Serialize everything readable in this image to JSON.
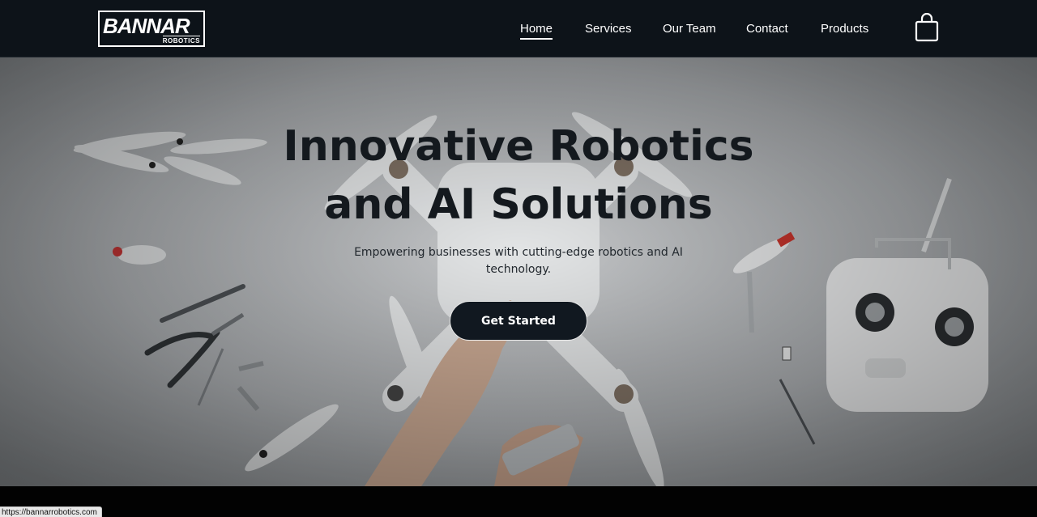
{
  "navbar": {
    "logo": {
      "main": "BANNAR",
      "sub": "ROBOTICS"
    },
    "links": [
      {
        "label": "Home",
        "active": true
      },
      {
        "label": "Services",
        "active": false
      },
      {
        "label": "Our Team",
        "active": false
      },
      {
        "label": "Contact",
        "active": false
      },
      {
        "label": "Products",
        "active": false
      }
    ],
    "cart_icon": "shopping-bag-icon"
  },
  "hero": {
    "title_line1": "Innovative Robotics",
    "title_line2": "and AI Solutions",
    "subtitle": "Empowering businesses with cutting-edge robotics and AI technology.",
    "cta_label": "Get Started"
  },
  "status_bar": {
    "url": "https://bannarrobotics.com"
  },
  "colors": {
    "navbar_bg": "#0d1319",
    "cta_bg": "#111820",
    "text_dark": "#14191e"
  }
}
